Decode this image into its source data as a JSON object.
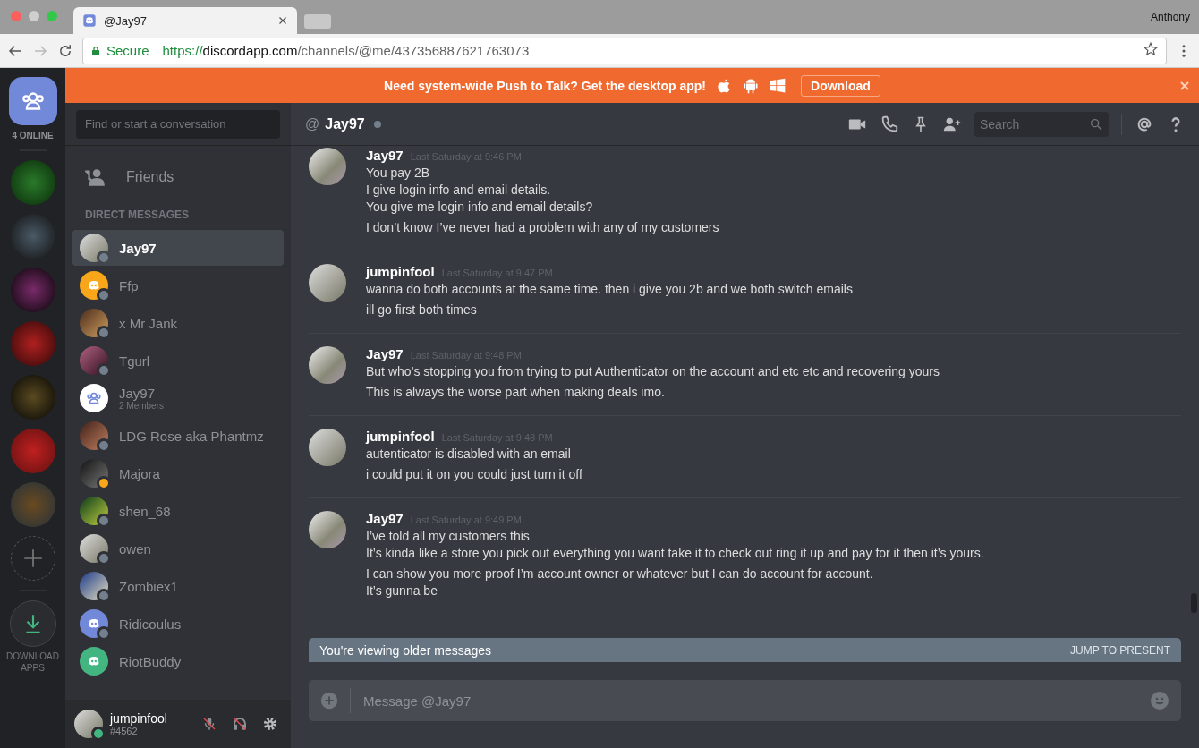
{
  "browser": {
    "tab": {
      "title": "@Jay97"
    },
    "profile": "Anthony",
    "address": {
      "security": "Secure",
      "scheme": "https://",
      "host": "discordapp.com",
      "path": "/channels/@me/437356887621763073"
    }
  },
  "banner": {
    "text": "Need system-wide Push to Talk? Get the desktop app!",
    "button": "Download"
  },
  "guilds": {
    "online": "4 ONLINE",
    "servers": [
      {
        "kind": "photo"
      },
      {
        "kind": "photo"
      },
      {
        "kind": "photo"
      },
      {
        "kind": "photo"
      },
      {
        "kind": "photo"
      },
      {
        "kind": "photo"
      },
      {
        "kind": "photo"
      }
    ],
    "download": "DOWNLOAD APPS"
  },
  "dm_list": {
    "search": {
      "placeholder": "Find or start a conversation"
    },
    "friends": "Friends",
    "section": "DIRECT MESSAGES",
    "items": [
      {
        "name": "Jay97",
        "selected": true,
        "avatar": {
          "kind": "photo"
        },
        "status": {
          "color": "#747f8d"
        }
      },
      {
        "name": "Ffp",
        "selected": false,
        "avatar": {
          "kind": "discord",
          "color": "#faa61a"
        },
        "status": {
          "color": "#747f8d"
        }
      },
      {
        "name": "x Mr Jank",
        "selected": false,
        "avatar": {
          "kind": "photo"
        },
        "status": {
          "color": "#747f8d"
        }
      },
      {
        "name": "Tgurl",
        "selected": false,
        "avatar": {
          "kind": "photo"
        },
        "status": {
          "color": "#747f8d"
        }
      },
      {
        "name": "Jay97",
        "subtitle": "2 Members",
        "selected": false,
        "avatar": {
          "kind": "group"
        }
      },
      {
        "name": "LDG Rose aka Phantmz",
        "selected": false,
        "avatar": {
          "kind": "photo"
        },
        "status": {
          "color": "#747f8d"
        }
      },
      {
        "name": "Majora",
        "selected": false,
        "avatar": {
          "kind": "photo"
        },
        "status": {
          "color": "#faa61a"
        }
      },
      {
        "name": "shen_68",
        "selected": false,
        "avatar": {
          "kind": "photo"
        },
        "status": {
          "color": "#747f8d"
        }
      },
      {
        "name": "owen",
        "selected": false,
        "avatar": {
          "kind": "photo"
        },
        "status": {
          "color": "#747f8d"
        }
      },
      {
        "name": "Zombiex1",
        "selected": false,
        "avatar": {
          "kind": "photo"
        },
        "status": {
          "color": "#747f8d"
        }
      },
      {
        "name": "Ridicoulus",
        "selected": false,
        "avatar": {
          "kind": "discord",
          "color": "#7289da"
        },
        "status": {
          "color": "#747f8d"
        }
      },
      {
        "name": "RiotBuddy",
        "selected": false,
        "avatar": {
          "kind": "discord",
          "color": "#43b581"
        }
      }
    ]
  },
  "user": {
    "name": "jumpinfool",
    "tag": "#4562",
    "status": {
      "color": "#43b581"
    },
    "mic_muted": true,
    "deafened": true
  },
  "chat": {
    "prefix": "@",
    "title": "Jay97",
    "status": {
      "color": "#747f8d"
    },
    "search": {
      "placeholder": "Search"
    },
    "messages": [
      {
        "author": "Jay97",
        "time": "Last Saturday at 9:46 PM",
        "blocks": [
          [
            "You pay 2B",
            "I give login info and email details.",
            "You give me login info and email details?"
          ],
          [
            "I don’t know I’ve never had a problem with any of my customers"
          ]
        ]
      },
      {
        "author": "jumpinfool",
        "time": "Last Saturday at 9:47 PM",
        "blocks": [
          [
            "wanna do both accounts at the same time. then i give you 2b and we both switch emails"
          ],
          [
            "ill go first both times"
          ]
        ]
      },
      {
        "author": "Jay97",
        "time": "Last Saturday at 9:48 PM",
        "blocks": [
          [
            "But who’s stopping you from trying to put Authenticator on the account and etc etc and recovering yours"
          ],
          [
            "This is always the worse part when making deals imo."
          ]
        ]
      },
      {
        "author": "jumpinfool",
        "time": "Last Saturday at 9:48 PM",
        "blocks": [
          [
            "autenticator is disabled with an email"
          ],
          [
            "i could put it on you could just turn it off"
          ]
        ]
      },
      {
        "author": "Jay97",
        "time": "Last Saturday at 9:49 PM",
        "blocks": [
          [
            "I’ve told all my customers this",
            "It’s kinda like a store you pick out everything you want take it to check out ring it up and pay for it then it’s yours."
          ],
          [
            "I can show you more proof I’m account owner or whatever but I can do account for account.",
            "It’s gunna be"
          ]
        ]
      }
    ],
    "older_bar": {
      "text": "You're viewing older messages",
      "action": "JUMP TO PRESENT"
    },
    "composer": {
      "placeholder": "Message @Jay97"
    }
  }
}
